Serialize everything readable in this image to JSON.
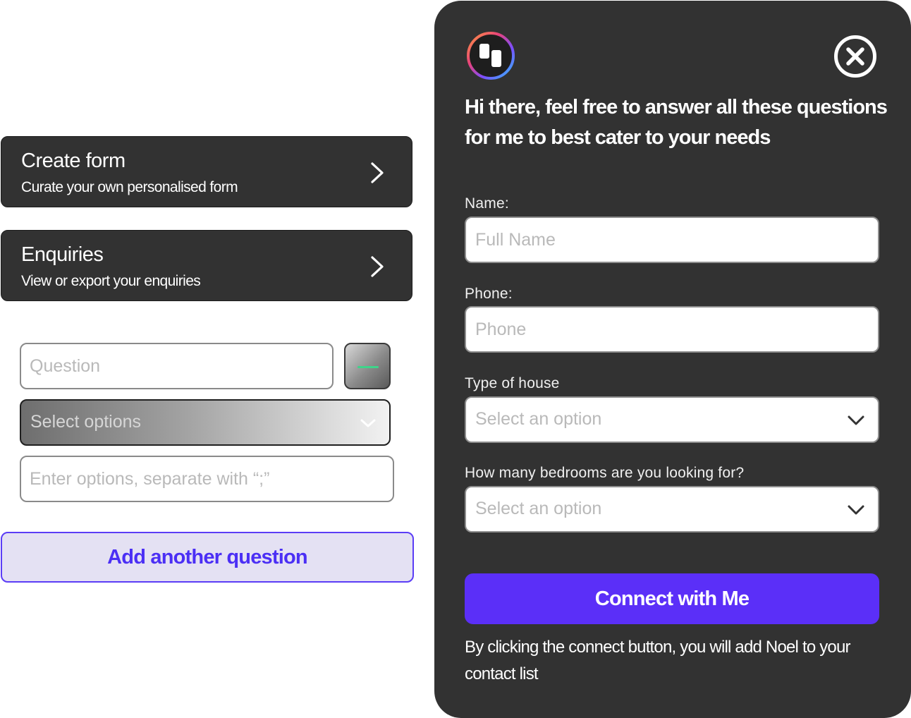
{
  "menu": [
    {
      "title": "Create form",
      "subtitle": "Curate your own personalised form"
    },
    {
      "title": "Enquiries",
      "subtitle": "View or export your enquiries"
    }
  ],
  "builder": {
    "question_placeholder": "Question",
    "select_label": "Select options",
    "options_placeholder": "Enter options, separate with “;”",
    "add_question_label": "Add another question"
  },
  "form": {
    "headline": "Hi there, feel free to answer all these questions for me to best cater to your needs",
    "name_label": "Name:",
    "name_placeholder": "Full Name",
    "phone_label": "Phone:",
    "phone_placeholder": "Phone",
    "house_label": "Type of house",
    "house_select": "Select an option",
    "bedrooms_label": "How many bedrooms are you looking for?",
    "bedrooms_select": "Select an option",
    "connect_label": "Connect with Me",
    "disclaimer": "By clicking the connect button, you will add Noel to your contact list"
  },
  "colors": {
    "panel": "#323232",
    "accent": "#5b2ff8",
    "add_button_bg": "#e4e1f3",
    "minus_bar": "#3fd48a"
  },
  "icons": {
    "menu_chevron": "chevron-right-icon",
    "select_chevron": "chevron-down-icon",
    "close": "close-circle-icon",
    "logo": "brand-logo-icon",
    "remove_question": "minus-icon"
  }
}
